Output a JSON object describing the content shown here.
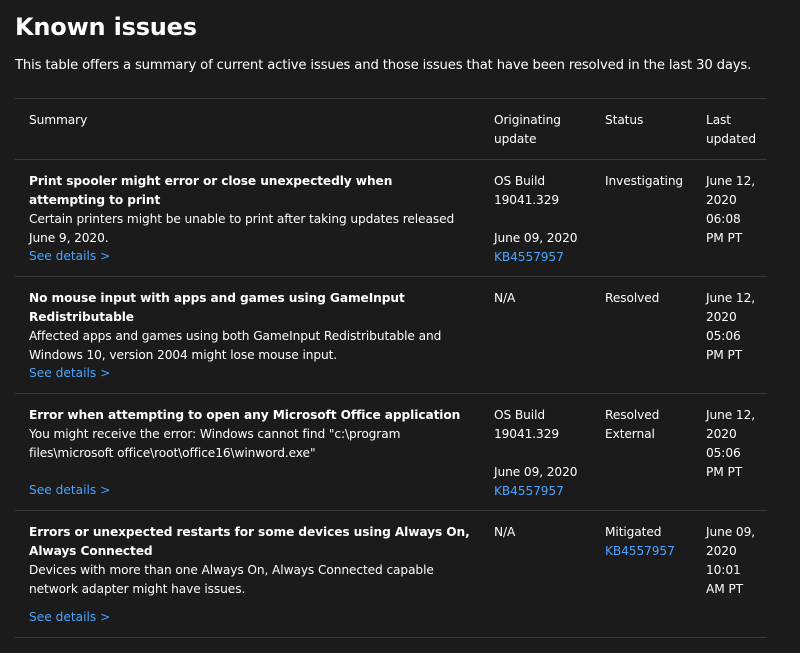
{
  "page": {
    "title": "Known issues",
    "intro": "This table offers a summary of current active issues and those issues that have been resolved in the last 30 days."
  },
  "table": {
    "headers": {
      "summary": "Summary",
      "originating_1": "Originating",
      "originating_2": "update",
      "status": "Status",
      "last_1": "Last",
      "last_2": "updated"
    },
    "rows": [
      {
        "title": "Print spooler might error or close unexpectedly when attempting to print",
        "desc": "Certain printers might be unable to print after taking updates released June 9, 2020.",
        "details": "See details >",
        "orig_build_1": "OS Build",
        "orig_build_2": "19041.329",
        "orig_date": "June 09, 2020",
        "orig_kb": "KB4557957",
        "status_1": "Investigating",
        "last": [
          "June 12,",
          "2020",
          "06:08",
          "PM PT"
        ]
      },
      {
        "title": "No mouse input with apps and games using GameInput Redistributable",
        "desc": "Affected apps and games using both GameInput Redistributable and Windows 10, version 2004 might lose mouse input.",
        "details": "See details >",
        "orig_na": "N/A",
        "status_1": "Resolved",
        "last": [
          "June 12,",
          "2020",
          "05:06",
          "PM PT"
        ]
      },
      {
        "title": "Error when attempting to open any Microsoft Office application",
        "desc": "You might receive the error: Windows cannot find \"c:\\program files\\microsoft office\\root\\office16\\winword.exe\"",
        "details": "See details >",
        "orig_build_1": "OS Build",
        "orig_build_2": "19041.329",
        "orig_date": "June 09, 2020",
        "orig_kb": "KB4557957",
        "status_1": "Resolved",
        "status_2": "External",
        "last": [
          "June 12,",
          "2020",
          "05:06",
          "PM PT"
        ]
      },
      {
        "title": "Errors or unexpected restarts for some devices using Always On, Always Connected",
        "desc": "Devices with more than one Always On, Always Connected capable network adapter might have issues.",
        "details": "See details >",
        "orig_na": "N/A",
        "status_1": "Mitigated",
        "status_kb": "KB4557957",
        "last": [
          "June 09,",
          "2020",
          "10:01",
          "AM PT"
        ]
      }
    ]
  },
  "colors": {
    "background": "#1b1b1b",
    "text": "#ffffff",
    "link": "#4aa3ff",
    "divider": "#3a3a3a"
  }
}
